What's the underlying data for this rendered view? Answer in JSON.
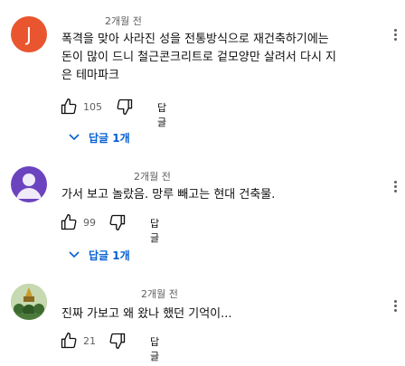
{
  "comments": [
    {
      "avatar_letter": "J",
      "avatar_color": "#e8552f",
      "time": "2개월 전",
      "lines": [
        "폭격을 맞아 사라진 성을 전통방식으로 재건축하기에는",
        "돈이 많이 드니 철근콘크리트로 겉모양만 살려서 다시 지",
        "은 테마파크"
      ],
      "likes": "105",
      "reply_label": "답글",
      "replies_label": "답글 1개"
    },
    {
      "avatar_icon": "default-person-avatar",
      "avatar_color": "#6c43bf",
      "time": "2개월 전",
      "lines": [
        "가서 보고 놀랐음. 망루 빼고는 현대 건축물."
      ],
      "likes": "99",
      "reply_label": "답글",
      "replies_label": "답글 1개"
    },
    {
      "avatar_icon": "profile-photo-avatar",
      "time": "2개월 전",
      "lines": [
        "진짜 가보고 왜 왔나 했던 기억이..."
      ],
      "likes": "21",
      "reply_label": "답글"
    }
  ],
  "colors": {
    "link": "#065fd4",
    "secondary_text": "#606060"
  }
}
